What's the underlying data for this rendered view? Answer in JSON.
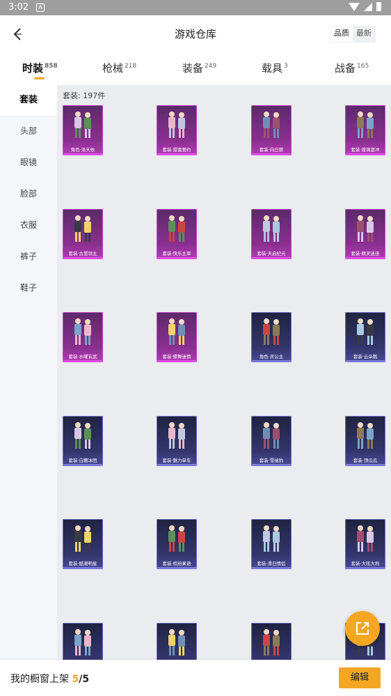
{
  "status": {
    "time": "3:02",
    "notification_icon": "A"
  },
  "header": {
    "title": "游戏仓库",
    "sort_options": [
      "品质",
      "最新"
    ],
    "active_sort": "品质"
  },
  "tabs": [
    {
      "label": "时装",
      "count": "858",
      "active": true
    },
    {
      "label": "枪械",
      "count": "218",
      "active": false
    },
    {
      "label": "装备",
      "count": "249",
      "active": false
    },
    {
      "label": "载具",
      "count": "3",
      "active": false
    },
    {
      "label": "战备",
      "count": "165",
      "active": false
    }
  ],
  "sidebar": {
    "items": [
      {
        "label": "套装",
        "active": true
      },
      {
        "label": "头部",
        "active": false
      },
      {
        "label": "眼镜",
        "active": false
      },
      {
        "label": "脸部",
        "active": false
      },
      {
        "label": "衣服",
        "active": false
      },
      {
        "label": "裤子",
        "active": false
      },
      {
        "label": "鞋子",
        "active": false
      }
    ]
  },
  "content": {
    "count_label": "套装: 197件",
    "items": [
      {
        "label": "角色·洛天依",
        "rarity": "purple"
      },
      {
        "label": "套装·甜蜜誓约",
        "rarity": "purple"
      },
      {
        "label": "套装·向日葵",
        "rarity": "purple"
      },
      {
        "label": "套装·玻璃激冲",
        "rarity": "purple"
      },
      {
        "label": "套装·古堡领主",
        "rarity": "purple"
      },
      {
        "label": "套装·快乐主宰",
        "rarity": "purple"
      },
      {
        "label": "套装·天启纪元",
        "rarity": "purple"
      },
      {
        "label": "套装·精灵迷巫",
        "rarity": "purple"
      },
      {
        "label": "套装·水曜玄武",
        "rarity": "purple"
      },
      {
        "label": "套装·蝶舞迷情",
        "rarity": "purple"
      },
      {
        "label": "角色·灵公主",
        "rarity": "blue"
      },
      {
        "label": "套装·云朵鹅",
        "rarity": "blue"
      },
      {
        "label": "套装·白糯冰团",
        "rarity": "blue"
      },
      {
        "label": "套装·魅力单车",
        "rarity": "blue"
      },
      {
        "label": "套装·雪绒豹",
        "rarity": "blue"
      },
      {
        "label": "套装·顶瓜瓜",
        "rarity": "blue"
      },
      {
        "label": "套装·酷潮明星",
        "rarity": "blue"
      },
      {
        "label": "套装·缤纷果语",
        "rarity": "blue"
      },
      {
        "label": "套装·滑日情侣",
        "rarity": "blue"
      },
      {
        "label": "套装·大吼大利",
        "rarity": "blue"
      },
      {
        "label": "",
        "rarity": "blue"
      },
      {
        "label": "",
        "rarity": "blue"
      },
      {
        "label": "",
        "rarity": "blue"
      },
      {
        "label": "",
        "rarity": "blue"
      }
    ]
  },
  "footer": {
    "shelf_label": "我的橱窗上架",
    "shelf_current": "5",
    "shelf_separator": "/",
    "shelf_total": "5",
    "edit_label": "编辑"
  },
  "colors": {
    "accent": "#f5a623",
    "purple_card": "#8a2f8f",
    "blue_card": "#33356b"
  }
}
